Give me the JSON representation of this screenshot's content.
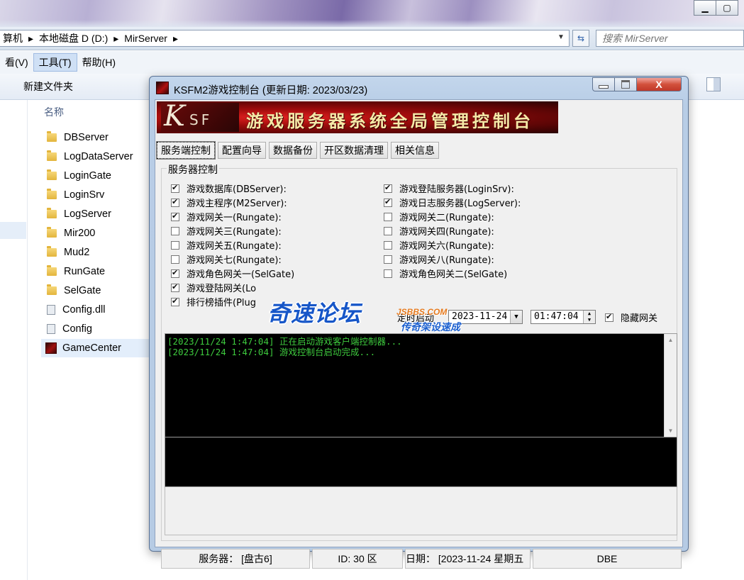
{
  "explorer": {
    "window_buttons": [
      "▁",
      "▢"
    ],
    "breadcrumb": [
      "算机",
      "本地磁盘 D (D:)",
      "MirServer"
    ],
    "search_placeholder": "搜索 MirServer",
    "menu": [
      "看(V)",
      "工具(T)",
      "帮助(H)"
    ],
    "toolbar_new_folder": "新建文件夹",
    "column_name": "名称",
    "files": [
      {
        "name": "DBServer",
        "icon": "folder-icon"
      },
      {
        "name": "LogDataServer",
        "icon": "folder-icon"
      },
      {
        "name": "LoginGate",
        "icon": "folder-icon"
      },
      {
        "name": "LoginSrv",
        "icon": "folder-icon"
      },
      {
        "name": "LogServer",
        "icon": "folder-icon"
      },
      {
        "name": "Mir200",
        "icon": "folder-icon"
      },
      {
        "name": "Mud2",
        "icon": "folder-icon"
      },
      {
        "name": "RunGate",
        "icon": "folder-icon"
      },
      {
        "name": "SelGate",
        "icon": "folder-icon"
      },
      {
        "name": "Config.dll",
        "icon": "dll-file-icon"
      },
      {
        "name": "Config",
        "icon": "config-file-icon"
      },
      {
        "name": "GameCenter",
        "icon": "app-icon"
      }
    ]
  },
  "dialog": {
    "title": "KSFM2游戏控制台 (更新日期: 2023/03/23)",
    "close_label": "X",
    "banner": {
      "logo_k": "K",
      "logo_sf": "SF",
      "text": "游戏服务器系统全局管理控制台"
    },
    "tabs": [
      "服务端控制",
      "配置向导",
      "数据备份",
      "开区数据清理",
      "相关信息"
    ],
    "group_label": "服务器控制",
    "servers_left": [
      {
        "label": "游戏数据库(DBServer):",
        "checked": true
      },
      {
        "label": "游戏主程序(M2Server):",
        "checked": true
      },
      {
        "label": "游戏网关一(Rungate):",
        "checked": true
      },
      {
        "label": "游戏网关三(Rungate):",
        "checked": false
      },
      {
        "label": "游戏网关五(Rungate):",
        "checked": false
      },
      {
        "label": "游戏网关七(Rungate):",
        "checked": false
      },
      {
        "label": "游戏角色网关一(SelGate)",
        "checked": true
      },
      {
        "label": "游戏登陆网关(Lo",
        "checked": true
      },
      {
        "label": "排行榜插件(Plug",
        "checked": true
      }
    ],
    "servers_right": [
      {
        "label": "游戏登陆服务器(LoginSrv):",
        "checked": true
      },
      {
        "label": "游戏日志服务器(LogServer):",
        "checked": true
      },
      {
        "label": "游戏网关二(Rungate):",
        "checked": false
      },
      {
        "label": "游戏网关四(Rungate):",
        "checked": false
      },
      {
        "label": "游戏网关六(Rungate):",
        "checked": false
      },
      {
        "label": "游戏网关八(Rungate):",
        "checked": false
      },
      {
        "label": "游戏角色网关二(SelGate)",
        "checked": false
      }
    ],
    "start_time_label": "定时启动",
    "date_value": "2023-11-24",
    "time_value": "01:47:04",
    "hide_gateway": {
      "label": "隐藏网关",
      "checked": true
    },
    "watermark": {
      "main": "奇速论坛",
      "sub": "传奇架设速成",
      "url": "JSBBS.COM"
    },
    "console_lines": [
      "[2023/11/24 1:47:04] 正在启动游戏客户端控制器...",
      "[2023/11/24 1:47:04] 游戏控制台启动完成..."
    ],
    "status": {
      "server": "服务器：  [盘古6]",
      "id": "ID: 30 区",
      "date": "日期：  [2023-11-24 星期五",
      "db": "DBE"
    }
  },
  "colors": {
    "console_text": "#3ecb3e",
    "banner_red": "#a00c0c",
    "watermark_blue": "#1656c8"
  }
}
